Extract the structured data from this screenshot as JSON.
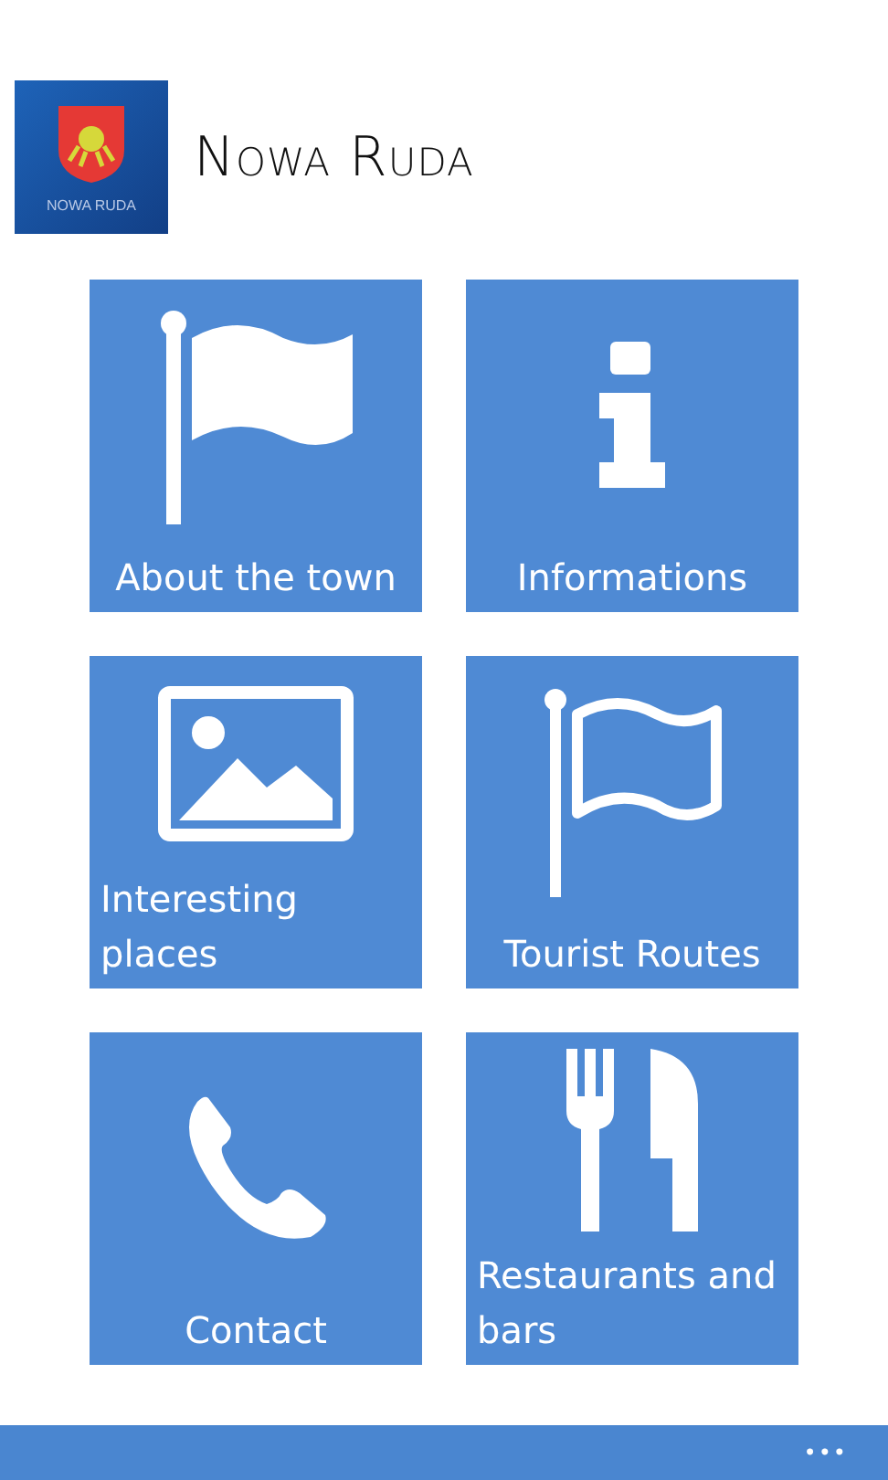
{
  "header": {
    "logo_caption": "NOWA RUDA",
    "title": "Nowa Ruda"
  },
  "tiles": [
    {
      "kind": "flag",
      "label": "About the town"
    },
    {
      "kind": "info",
      "label": "Informations"
    },
    {
      "kind": "image",
      "label": "Interesting places"
    },
    {
      "kind": "flag-outline",
      "label": "Tourist Routes"
    },
    {
      "kind": "phone",
      "label": "Contact"
    },
    {
      "kind": "cutlery",
      "label": "Restaurants and bars"
    }
  ],
  "app_bar": {
    "more": "•••"
  }
}
